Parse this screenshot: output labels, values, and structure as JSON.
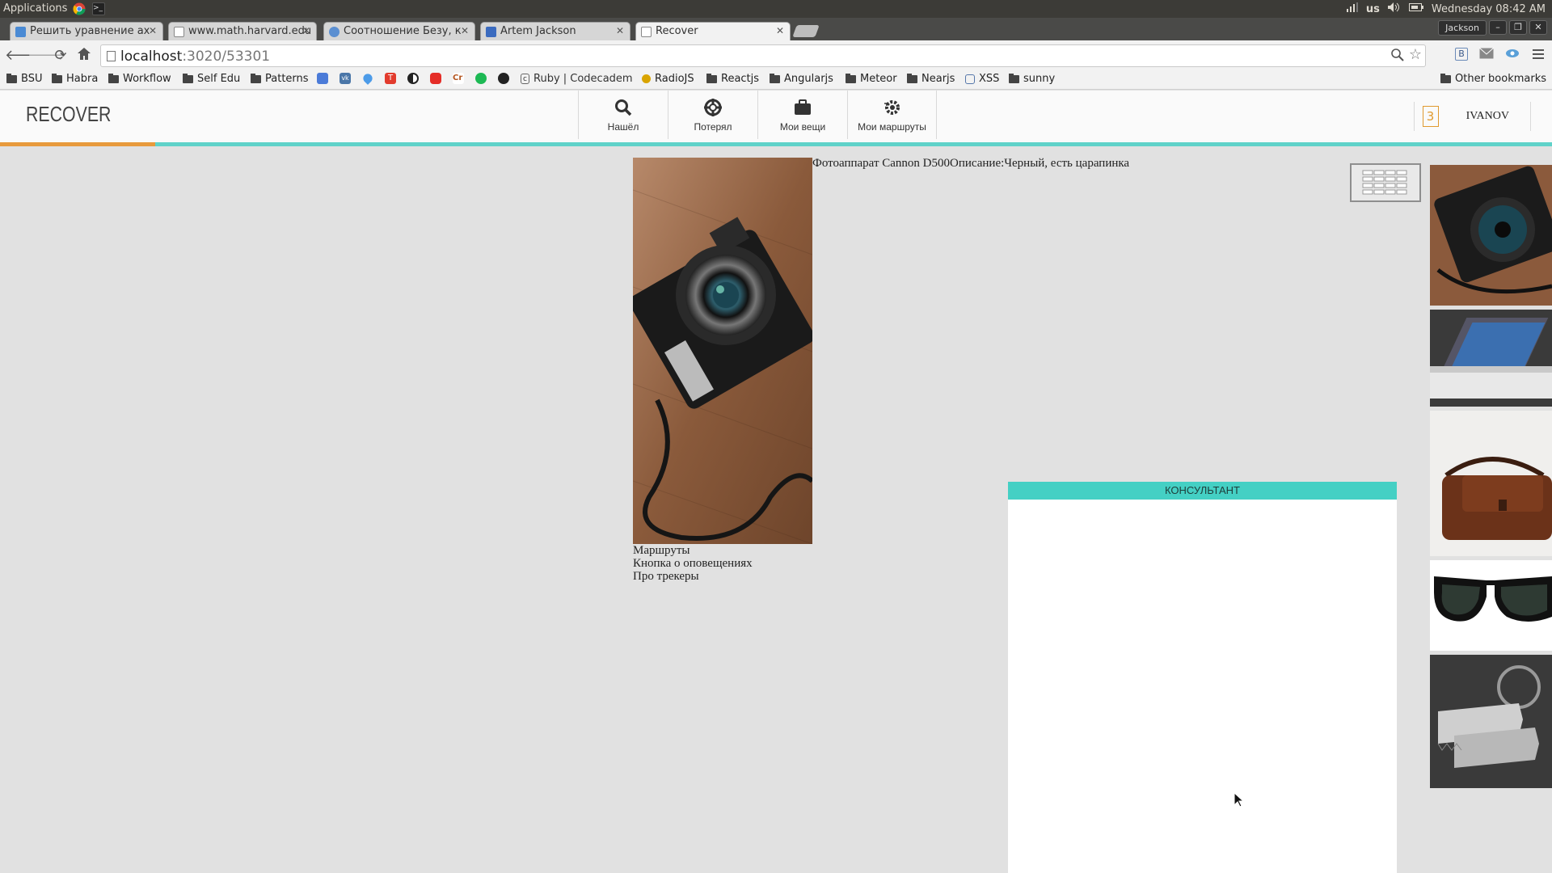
{
  "system_bar": {
    "applications": "Applications",
    "keyboard": "us",
    "clock": "Wednesday 08:42 AM"
  },
  "tabs": [
    {
      "title": "Решить уравнение ax",
      "favicon_color": "#4a8ad4"
    },
    {
      "title": "www.math.harvard.edu",
      "favicon_color": "#9e9e9e"
    },
    {
      "title": "Соотношение Безу, к",
      "favicon_color": "#5b8fd1"
    },
    {
      "title": "Artem Jackson",
      "favicon_color": "#3b6bbf"
    },
    {
      "title": "Recover",
      "favicon_color": "#9e9e9e",
      "active": true
    }
  ],
  "window": {
    "user": "Jackson",
    "minimize": "–",
    "restore": "❐",
    "close": "✕"
  },
  "address_bar": {
    "host": "localhost",
    "path": ":3020/53301"
  },
  "bookmarks": [
    {
      "label": "BSU",
      "type": "folder"
    },
    {
      "label": "Habra",
      "type": "folder"
    },
    {
      "label": "Workflow",
      "type": "folder"
    },
    {
      "label": "Self Edu",
      "type": "folder"
    },
    {
      "label": "Patterns",
      "type": "folder"
    },
    {
      "label": "",
      "type": "icon",
      "color": "#4b7bd8"
    },
    {
      "label": "",
      "type": "icon",
      "color": "#4a76a8"
    },
    {
      "label": "",
      "type": "icon",
      "color": "#4c9be8"
    },
    {
      "label": "",
      "type": "icon",
      "color": "#e23b2d"
    },
    {
      "label": "",
      "type": "icon",
      "color": "#222222"
    },
    {
      "label": "",
      "type": "icon",
      "color": "#e52d27"
    },
    {
      "label": "",
      "type": "icon",
      "color": "#b3541e"
    },
    {
      "label": "",
      "type": "icon",
      "color": "#1db954"
    },
    {
      "label": "",
      "type": "icon",
      "color": "#222222"
    },
    {
      "label": "Ruby | Codecadem",
      "type": "icon",
      "color": "#666666"
    },
    {
      "label": "RadioJS",
      "type": "icon",
      "color": "#d9a400"
    },
    {
      "label": "Reactjs",
      "type": "folder"
    },
    {
      "label": "Angularjs",
      "type": "folder"
    },
    {
      "label": "Meteor",
      "type": "folder"
    },
    {
      "label": "Nearjs",
      "type": "folder"
    },
    {
      "label": "XSS",
      "type": "icon",
      "color": "#5577aa"
    },
    {
      "label": "sunny",
      "type": "folder"
    }
  ],
  "other_bookmarks": "Other bookmarks",
  "app": {
    "logo": "RECOVER",
    "nav": [
      {
        "label": "Нашёл",
        "icon": "search-icon"
      },
      {
        "label": "Потерял",
        "icon": "lifebuoy-icon"
      },
      {
        "label": "Мои вещи",
        "icon": "briefcase-icon"
      },
      {
        "label": "Мои маршруты",
        "icon": "gear-route-icon"
      }
    ],
    "notification_count": "3",
    "username": "IVANOV",
    "accent_color": "#5fd2c9",
    "progress_color": "#e89a3c"
  },
  "item": {
    "description": "Фотоаппарат Cannon D500Описание:Черный, есть царапинка",
    "links": [
      "Маршруты",
      "Кнопка о оповещениях",
      "Про трекеры"
    ]
  },
  "thumbnails": [
    {
      "subject": "camera"
    },
    {
      "subject": "laptop"
    },
    {
      "subject": "leather bag"
    },
    {
      "subject": "sunglasses"
    },
    {
      "subject": "keys"
    }
  ],
  "chat": {
    "title": "КОНСУЛЬТАНТ"
  }
}
